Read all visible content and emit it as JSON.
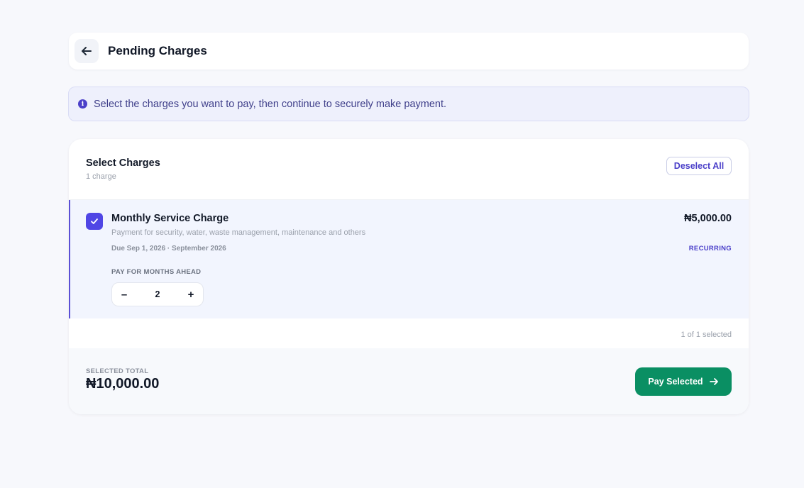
{
  "header": {
    "title": "Pending Charges",
    "back_icon": "arrow-left-icon"
  },
  "info_banner": {
    "icon": "info-icon",
    "icon_glyph": "i",
    "text": "Select the charges you want to pay, then continue to securely make payment."
  },
  "charges_card": {
    "title": "Select Charges",
    "subtitle": "1 charge",
    "deselect_label": "Deselect All",
    "items": [
      {
        "checked": true,
        "name": "Monthly Service Charge",
        "description": "Payment for security, water, waste management, maintenance and others",
        "due": "Due Sep 1, 2026 · September 2026",
        "amount": "₦5,000.00",
        "badge": "RECURRING",
        "months_label": "PAY FOR MONTHS AHEAD",
        "decrement_glyph": "–",
        "months_value": "2",
        "increment_glyph": "+"
      }
    ],
    "selected_count": "1 of 1 selected"
  },
  "footer": {
    "total_label": "SELECTED TOTAL",
    "total_value": "₦10,000.00",
    "pay_label": "Pay Selected",
    "pay_icon": "arrow-right-icon"
  },
  "colors": {
    "accent": "#5046e5",
    "pay_button": "#0a8f63",
    "banner_bg": "#eef0fc",
    "selected_row_bg": "#f2f5fe"
  }
}
